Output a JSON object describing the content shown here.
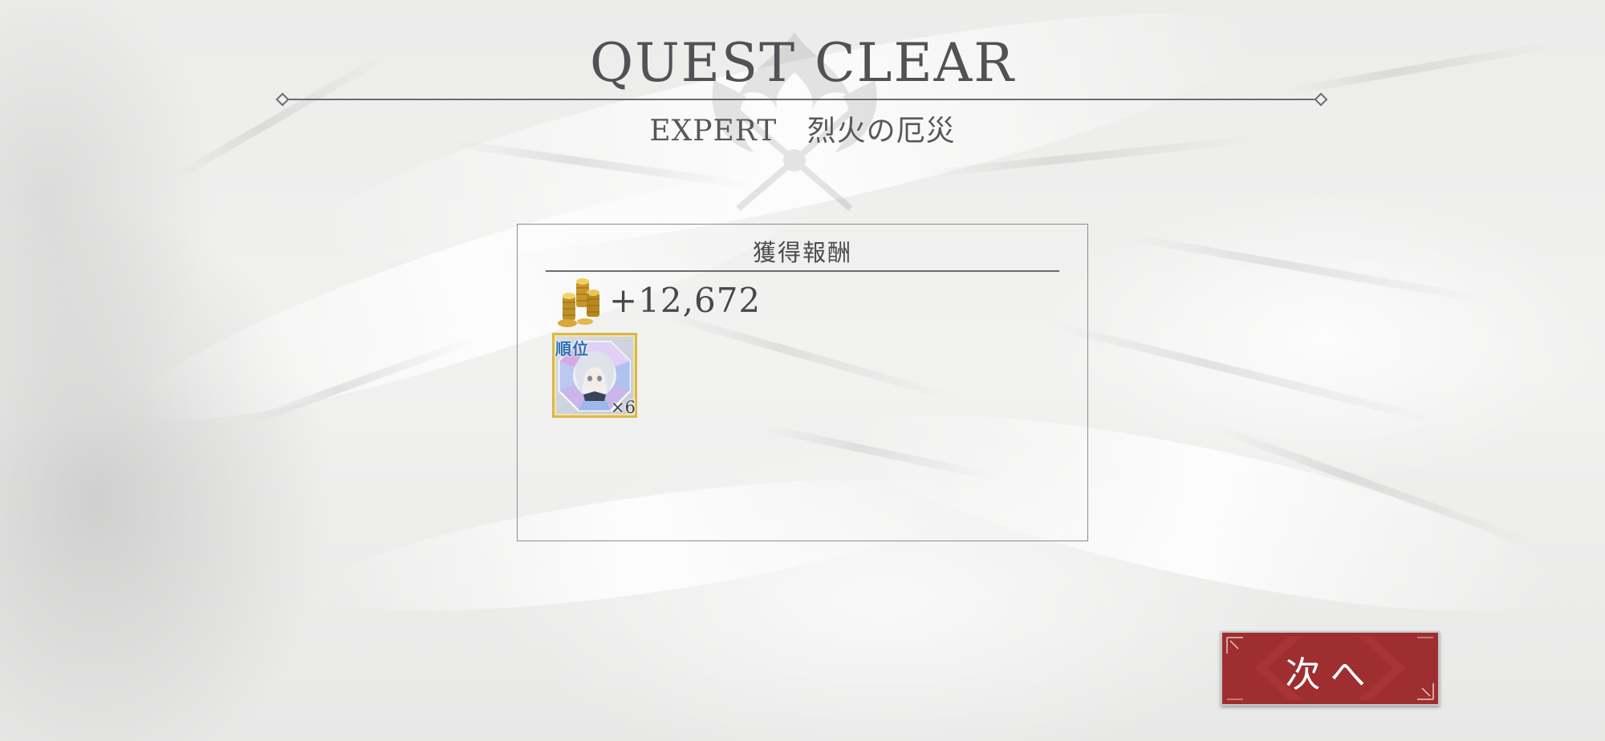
{
  "header": {
    "title": "QUEST CLEAR",
    "difficulty": "EXPERT",
    "quest_name": "烈火の厄災"
  },
  "rewards": {
    "heading": "獲得報酬",
    "coins": {
      "icon": "gold-coins-icon",
      "amount": "+12,672"
    },
    "items": [
      {
        "icon": "character-crystal-icon",
        "badge": "順位",
        "count": "×6"
      }
    ]
  },
  "actions": {
    "next_label": "次へ"
  },
  "colors": {
    "button_red": "#9e2e30",
    "text_gray": "#505255",
    "frame_gold": "#d9b84a"
  }
}
